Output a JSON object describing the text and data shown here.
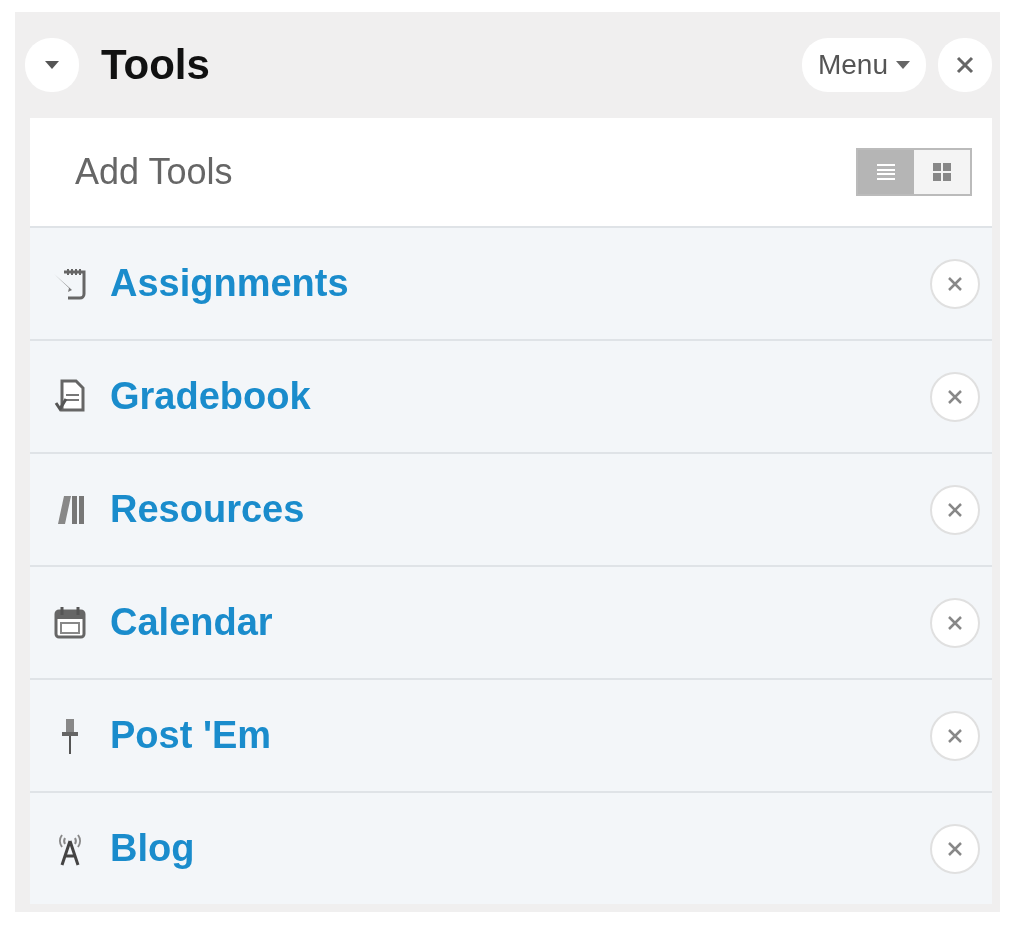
{
  "panel": {
    "title": "Tools",
    "expanded": true,
    "menu_label": "Menu"
  },
  "add_tools": {
    "label": "Add Tools",
    "views": [
      {
        "kind": "list",
        "selected": true
      },
      {
        "kind": "grid",
        "selected": false
      }
    ]
  },
  "tools": [
    {
      "kind": "assignments",
      "label": "Assignments"
    },
    {
      "kind": "gradebook",
      "label": "Gradebook"
    },
    {
      "kind": "resources",
      "label": "Resources"
    },
    {
      "kind": "calendar",
      "label": "Calendar"
    },
    {
      "kind": "pin",
      "label": "Post 'Em"
    },
    {
      "kind": "blog",
      "label": "Blog"
    }
  ]
}
